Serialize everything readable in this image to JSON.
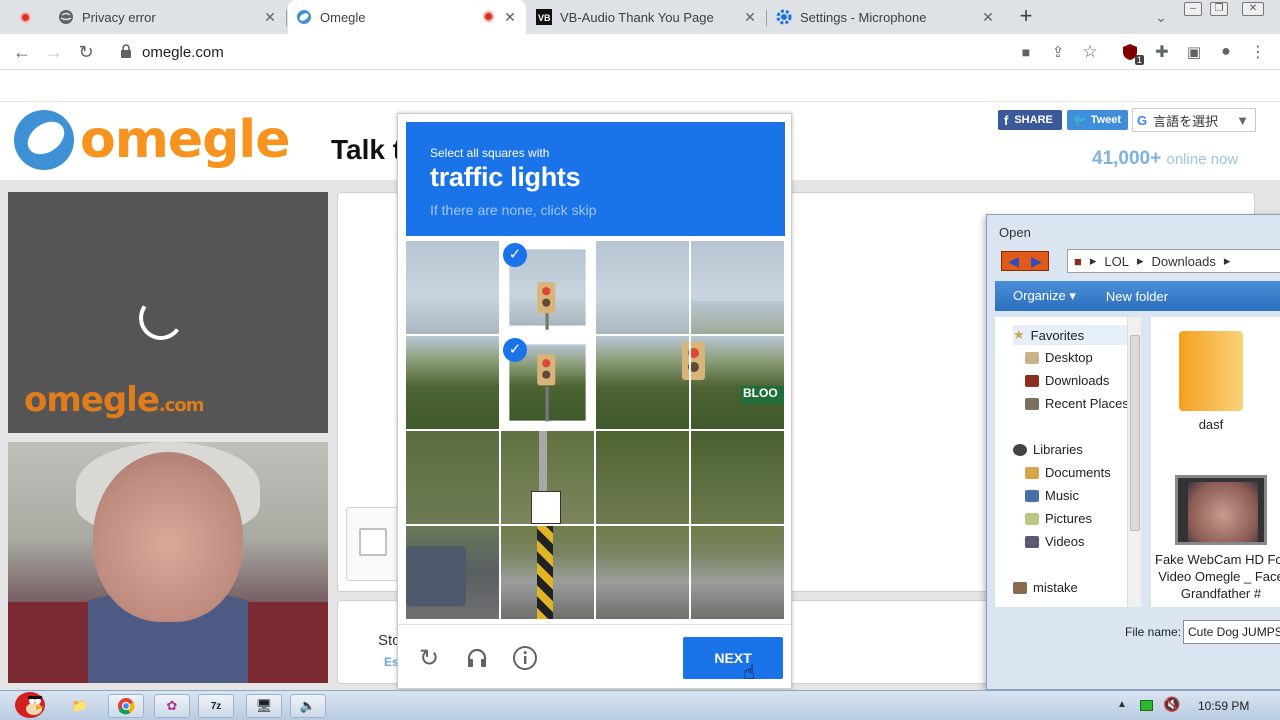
{
  "browser": {
    "tabs": [
      {
        "title": "Privacy error",
        "recording": true,
        "active": false
      },
      {
        "title": "Omegle",
        "recording": true,
        "active": true
      },
      {
        "title": "VB-Audio Thank You Page",
        "recording": false,
        "active": false
      },
      {
        "title": "Settings - Microphone",
        "recording": false,
        "active": false
      }
    ],
    "new_tab_label": "+",
    "address": "omegle.com",
    "extension_badge": "1"
  },
  "page": {
    "logo_text": "omegle",
    "tagline": "Talk t",
    "share_fb": "SHARE",
    "share_tw": "Tweet",
    "translate_label": "言語を選択",
    "online_count": "41,000+",
    "online_text": "online now",
    "video_logo_main": "omegle",
    "video_logo_suffix": ".com",
    "stop_label": "Sto",
    "esc_label": "Es"
  },
  "captcha": {
    "line1": "Select all squares with",
    "line2": "traffic lights",
    "line3": "If there are none, click skip",
    "selected_cells": [
      1,
      5
    ],
    "next_label": "NEXT",
    "sign_text": "BLOO"
  },
  "dialog": {
    "title": "Open",
    "path": [
      "LOL",
      "Downloads"
    ],
    "toolbar": {
      "organize": "Organize",
      "new_folder": "New folder"
    },
    "nav": {
      "favorites": "Favorites",
      "desktop": "Desktop",
      "downloads": "Downloads",
      "recent": "Recent Places",
      "libraries": "Libraries",
      "documents": "Documents",
      "music": "Music",
      "pictures": "Pictures",
      "videos": "Videos",
      "mistake": "mistake"
    },
    "files": {
      "folder_name": "dasf",
      "video_name": "Fake WebCam HD For Video Omegle _ Face Grandfather #"
    },
    "filename_label": "File name:",
    "filename_value": "Cute Dog JUMPSCARE"
  },
  "taskbar": {
    "clock": "10:59 PM"
  }
}
